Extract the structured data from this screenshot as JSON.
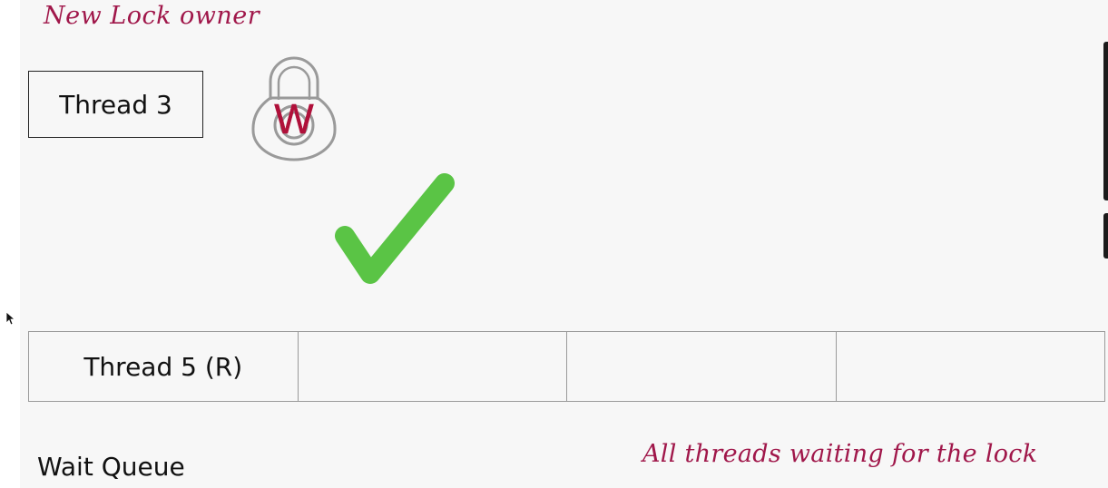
{
  "diagram": {
    "new_owner_note": "New Lock owner",
    "owner_thread": "Thread 3",
    "lock": {
      "label": "W",
      "icon": "lock-icon",
      "label_color": "#b0103a",
      "outline_color": "#9a9a9a"
    },
    "status_icon": "checkmark-icon",
    "status_color": "#5ac445",
    "wait_queue": {
      "slots": [
        "Thread 5 (R)",
        "",
        "",
        ""
      ],
      "label": "Wait Queue",
      "note": "All threads waiting for the lock"
    },
    "accent_color": "#a0174a"
  }
}
